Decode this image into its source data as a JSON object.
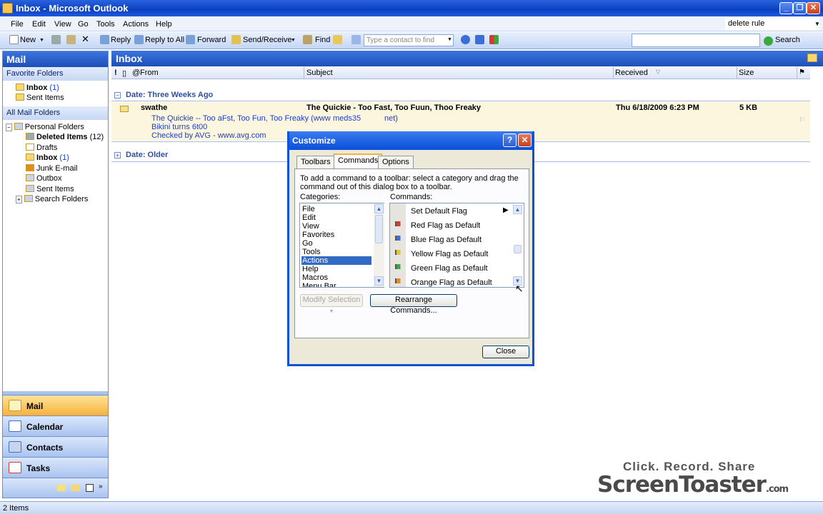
{
  "window": {
    "title": "Inbox - Microsoft Outlook"
  },
  "menubar": {
    "items": [
      "File",
      "Edit",
      "View",
      "Go",
      "Tools",
      "Actions",
      "Help"
    ],
    "help_search": "delete rule"
  },
  "toolbar": {
    "new": "New",
    "reply": "Reply",
    "reply_all": "Reply to All",
    "forward": "Forward",
    "send_receive": "Send/Receive",
    "find": "Find",
    "contact_placeholder": "Type a contact to find",
    "search": "Search"
  },
  "nav": {
    "title": "Mail",
    "favorite_header": "Favorite Folders",
    "favorites": [
      {
        "label": "Inbox",
        "count": "(1)"
      },
      {
        "label": "Sent Items",
        "count": ""
      }
    ],
    "all_header": "All Mail Folders",
    "root": "Personal Folders",
    "folders": [
      {
        "label": "Deleted Items",
        "count": "(12)"
      },
      {
        "label": "Drafts",
        "count": ""
      },
      {
        "label": "Inbox",
        "count": "(1)"
      },
      {
        "label": "Junk E-mail",
        "count": ""
      },
      {
        "label": "Outbox",
        "count": ""
      },
      {
        "label": "Sent Items",
        "count": ""
      },
      {
        "label": "Search Folders",
        "count": ""
      }
    ],
    "buttons": [
      "Mail",
      "Calendar",
      "Contacts",
      "Tasks"
    ]
  },
  "main": {
    "title": "Inbox",
    "columns": {
      "from": "From",
      "subject": "Subject",
      "received": "Received",
      "size": "Size"
    },
    "group1": "Date: Three Weeks Ago",
    "group2": "Date: Older",
    "message": {
      "from": "swathe",
      "subject": "The Quickie - Too Fast, Too Fuun, Thoo Freaky",
      "received": "Thu 6/18/2009 6:23 PM",
      "size": "5 KB",
      "preview_line1": "The Quickie -- Too aFst, Too Fun, Too Freaky (www",
      "preview_line1b": "meds35",
      "preview_line1c": "net)",
      "preview_line2": "Bikini turns 6t00",
      "preview_line3": "Checked by AVG - www.avg.com"
    }
  },
  "dialog": {
    "title": "Customize",
    "tabs": [
      "Toolbars",
      "Commands",
      "Options"
    ],
    "instructions_1": "To add a command to a toolbar: select a category and drag the",
    "instructions_2": "command out of this dialog box to a toolbar.",
    "categories_label": "Categories:",
    "commands_label": "Commands:",
    "categories": [
      "File",
      "Edit",
      "View",
      "Favorites",
      "Go",
      "Tools",
      "Actions",
      "Help",
      "Macros",
      "Menu Bar"
    ],
    "selected_category": "Actions",
    "commands": [
      "Set Default Flag",
      "Red Flag as Default",
      "Blue Flag as Default",
      "Yellow Flag as Default",
      "Green Flag as Default",
      "Orange Flag as Default"
    ],
    "modify_selection": "Modify Selection",
    "rearrange": "Rearrange Commands...",
    "close": "Close",
    "flag_colors": [
      "#d93a2b",
      "#3a6ed9",
      "#e2c829",
      "#3aa83a",
      "#e68a1a"
    ]
  },
  "status": {
    "items": "2 Items"
  },
  "watermark": {
    "line1": "Click. Record. Share",
    "line2": "ScreenToaster",
    "suffix": ".com"
  }
}
